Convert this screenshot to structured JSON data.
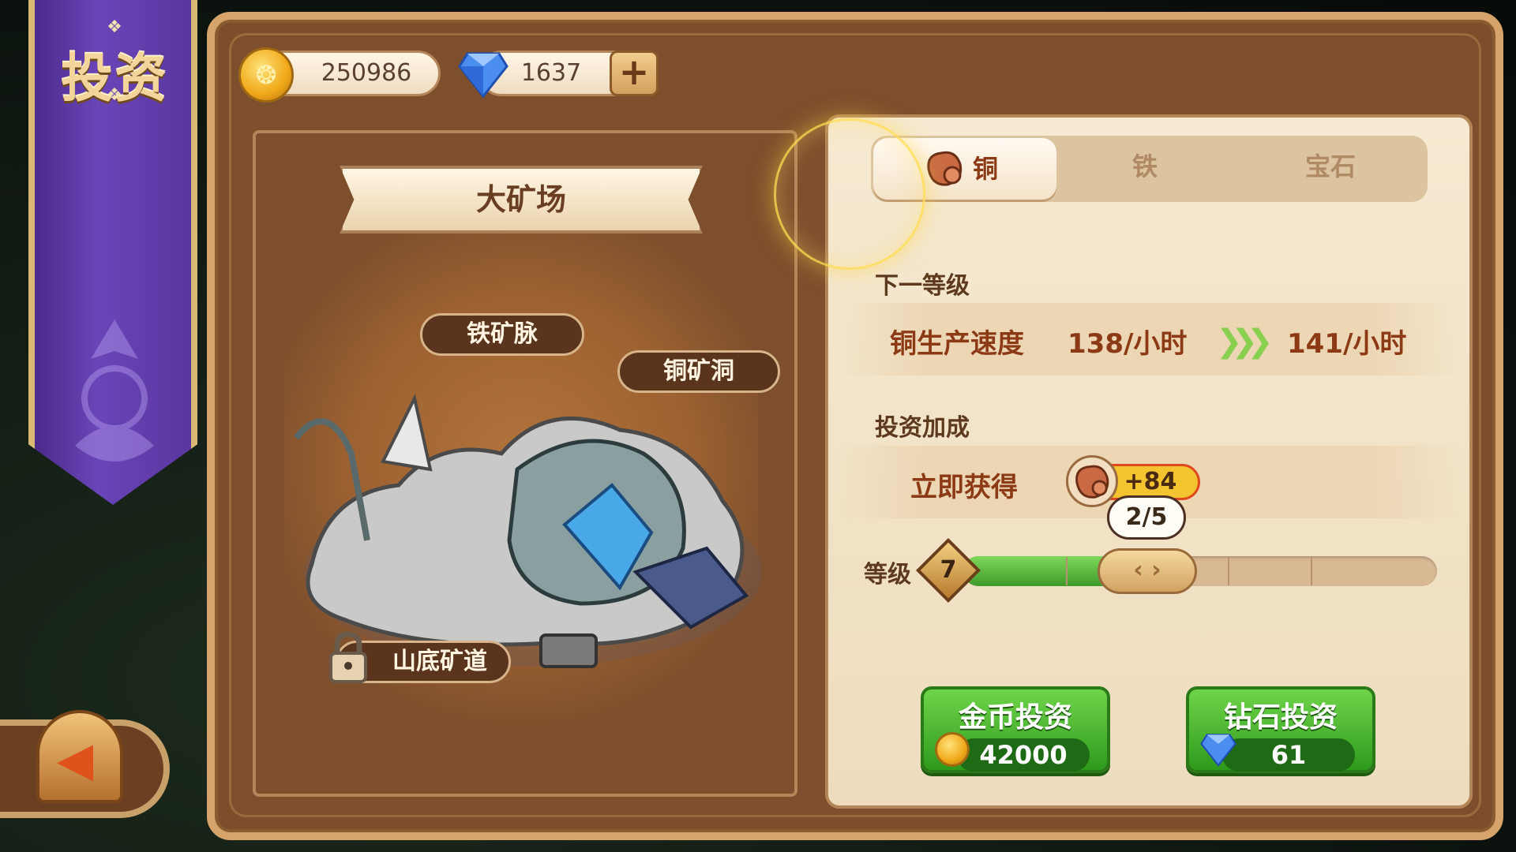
{
  "screen_title": "投资",
  "currency": {
    "gold": "250986",
    "diamond": "1637"
  },
  "left": {
    "site_title": "大矿场",
    "locations": {
      "iron_vein": "铁矿脉",
      "copper_cave": "铜矿洞",
      "mountain_tunnel": "山底矿道"
    }
  },
  "tabs": [
    {
      "label": "铜",
      "selected": true
    },
    {
      "label": "铁",
      "selected": false
    },
    {
      "label": "宝石",
      "selected": false
    }
  ],
  "next_level": {
    "heading": "下一等级",
    "stat_label": "铜生产速度",
    "current": "138/小时",
    "next": "141/小时"
  },
  "invest_bonus": {
    "heading": "投资加成",
    "label": "立即获得",
    "amount": "+84"
  },
  "level": {
    "label": "等级",
    "value": "7",
    "progress_text": "2/5",
    "progress_fraction": 0.4
  },
  "buttons": {
    "gold_invest": {
      "label": "金币投资",
      "cost": "42000"
    },
    "diamond_invest": {
      "label": "钻石投资",
      "cost": "61"
    }
  },
  "colors": {
    "frame_brown": "#7c4e2c",
    "parchment": "#f6ead2",
    "accent_red": "#8c3a16",
    "button_green": "#3fb02a",
    "banner_purple": "#5a36a0"
  }
}
